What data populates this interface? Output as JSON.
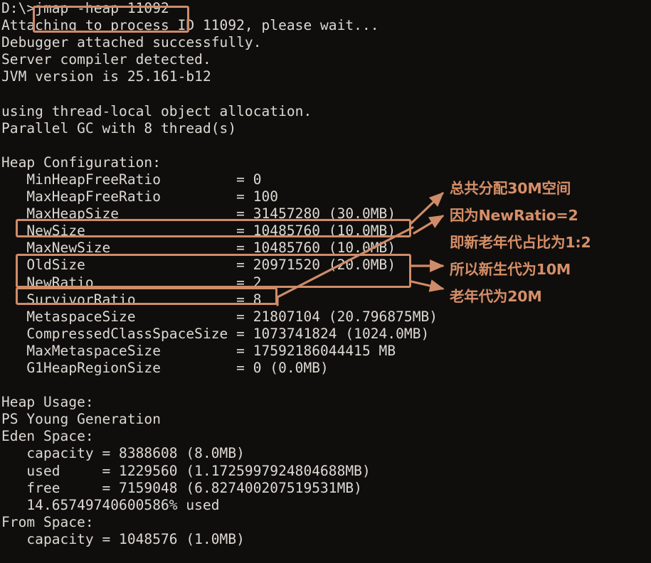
{
  "terminal": {
    "prompt_line": "D:\\>jmap -heap 11092",
    "lines": [
      "D:\\>jmap -heap 11092",
      "Attaching to process ID 11092, please wait...",
      "Debugger attached successfully.",
      "Server compiler detected.",
      "JVM version is 25.161-b12",
      "",
      "using thread-local object allocation.",
      "Parallel GC with 8 thread(s)",
      "",
      "Heap Configuration:",
      "   MinHeapFreeRatio         = 0",
      "   MaxHeapFreeRatio         = 100",
      "   MaxHeapSize              = 31457280 (30.0MB)",
      "   NewSize                  = 10485760 (10.0MB)",
      "   MaxNewSize               = 10485760 (10.0MB)",
      "   OldSize                  = 20971520 (20.0MB)",
      "   NewRatio                 = 2",
      "   SurvivorRatio            = 8",
      "   MetaspaceSize            = 21807104 (20.796875MB)",
      "   CompressedClassSpaceSize = 1073741824 (1024.0MB)",
      "   MaxMetaspaceSize         = 17592186044415 MB",
      "   G1HeapRegionSize         = 0 (0.0MB)",
      "",
      "Heap Usage:",
      "PS Young Generation",
      "Eden Space:",
      "   capacity = 8388608 (8.0MB)",
      "   used     = 1229560 (1.1725997924804688MB)",
      "   free     = 7159048 (6.827400207519531MB)",
      "   14.65749740600586% used",
      "From Space:",
      "   capacity = 1048576 (1.0MB)"
    ]
  },
  "annotations": {
    "accent_color": "#d68f68",
    "highlight_color": "#cf8c68",
    "notes": [
      {
        "text": "总共分配30M空间"
      },
      {
        "text": "因为NewRatio=2"
      },
      {
        "text": "即新老年代占比为1:2"
      },
      {
        "text": "所以新生代为10M"
      },
      {
        "text": "老年代为20M"
      }
    ],
    "boxes": [
      {
        "label": "command-highlight-box"
      },
      {
        "label": "maxheapsize-highlight-box"
      },
      {
        "label": "maxnewsize-oldsize-highlight-box"
      },
      {
        "label": "newratio-highlight-box"
      }
    ]
  },
  "colors": {
    "background": "#100e0d",
    "terminal_text": "#dcdad2",
    "accent": "#d68f68"
  }
}
